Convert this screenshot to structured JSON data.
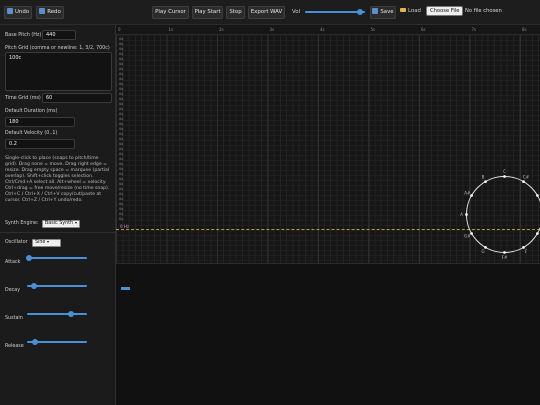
{
  "toolbar": {
    "undo_label": "Undo",
    "redo_label": "Redo",
    "play_cursor_label": "Play Cursor",
    "play_start_label": "Play Start",
    "stop_label": "Stop",
    "export_label": "Export WAV",
    "vol_label": "Vol",
    "volume": 0.92,
    "save_label": "Save",
    "load_label": "Load",
    "choose_file_label": "Choose File",
    "no_file_label": "No file chosen"
  },
  "panel": {
    "base_pitch_label": "Base Pitch (Hz)",
    "base_pitch_value": "440",
    "pitch_grid_label": "Pitch Grid (comma or newline: 1, 3/2, 700c)",
    "pitch_grid_value": "100c",
    "time_grid_label": "Time Grid (ms)",
    "time_grid_value": "60",
    "duration_label": "Default Duration (ms)",
    "duration_value": "180",
    "velocity_label": "Default Velocity (0..1)",
    "velocity_value": "0.2",
    "help_text": "Single-click to place (snaps to pitch/time grid). Drag none = move. Drag right edge = resize. Drag empty space = marquee (partial overlap). Shift+click toggles selection. Ctrl/Cmd+A select all. Alt+wheel = velocity. Ctrl+drag = free move/resize (no time snap). Ctrl+C / Ctrl+X / Ctrl+V copy/cut/paste at cursor. Ctrl+Z / Ctrl+Y undo/redo.",
    "synth_engine_label": "Synth Engine:",
    "synth_engine_value": "Basic Synth",
    "oscillator_label": "Oscillator",
    "oscillator_value": "Sine",
    "attack_label": "Attack",
    "attack_value": 0.04,
    "decay_label": "Decay",
    "decay_value": 0.12,
    "sustain_label": "Sustain",
    "sustain_value": 0.74,
    "release_label": "Release",
    "release_value": 0.14
  },
  "canvas": {
    "ruler_labels": [
      "0",
      "1s",
      "2s",
      "3s",
      "4s",
      "5s",
      "6s",
      "7s",
      "8s"
    ],
    "row_label": "0¢",
    "highlight_label": "0 Hz",
    "pitch_circle_labels": [
      "C",
      "C#",
      "D",
      "D#",
      "E",
      "F",
      "F#",
      "G",
      "G#",
      "A",
      "A#",
      "B"
    ],
    "colors": {
      "accent": "#4a90d9",
      "guide": "#b59a3a",
      "highlight": "#d087c8"
    }
  }
}
